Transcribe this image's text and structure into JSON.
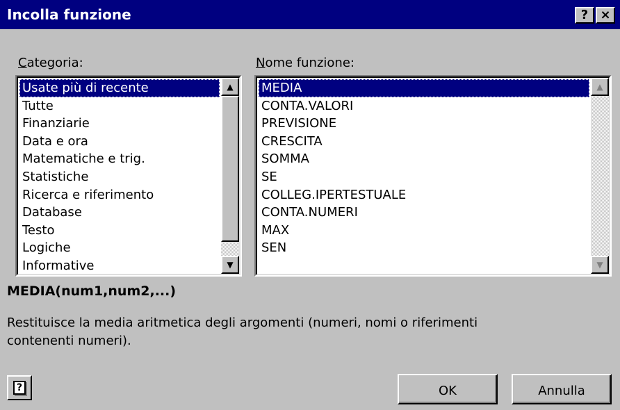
{
  "window": {
    "title": "Incolla funzione",
    "help_button": "?",
    "close_button": "×"
  },
  "category": {
    "label_accel": "C",
    "label_rest": "ategoria:",
    "items": [
      "Usate più di recente",
      "Tutte",
      "Finanziarie",
      "Data e ora",
      "Matematiche e trig.",
      "Statistiche",
      "Ricerca e riferimento",
      "Database",
      "Testo",
      "Logiche",
      "Informative"
    ],
    "selected_index": 0
  },
  "function": {
    "label_accel": "N",
    "label_rest": "ome funzione:",
    "items": [
      "MEDIA",
      "CONTA.VALORI",
      "PREVISIONE",
      "CRESCITA",
      "SOMMA",
      "SE",
      "COLLEG.IPERTESTUALE",
      "CONTA.NUMERI",
      "MAX",
      "SEN"
    ],
    "selected_index": 0
  },
  "syntax": "MEDIA(num1,num2,...)",
  "description": "Restituisce la media aritmetica degli argomenti (numeri, nomi o riferimenti contenenti numeri).",
  "buttons": {
    "ok": "OK",
    "cancel": "Annulla"
  },
  "icons": {
    "up_arrow": "▲",
    "down_arrow": "▼",
    "office_assistant": "?"
  }
}
